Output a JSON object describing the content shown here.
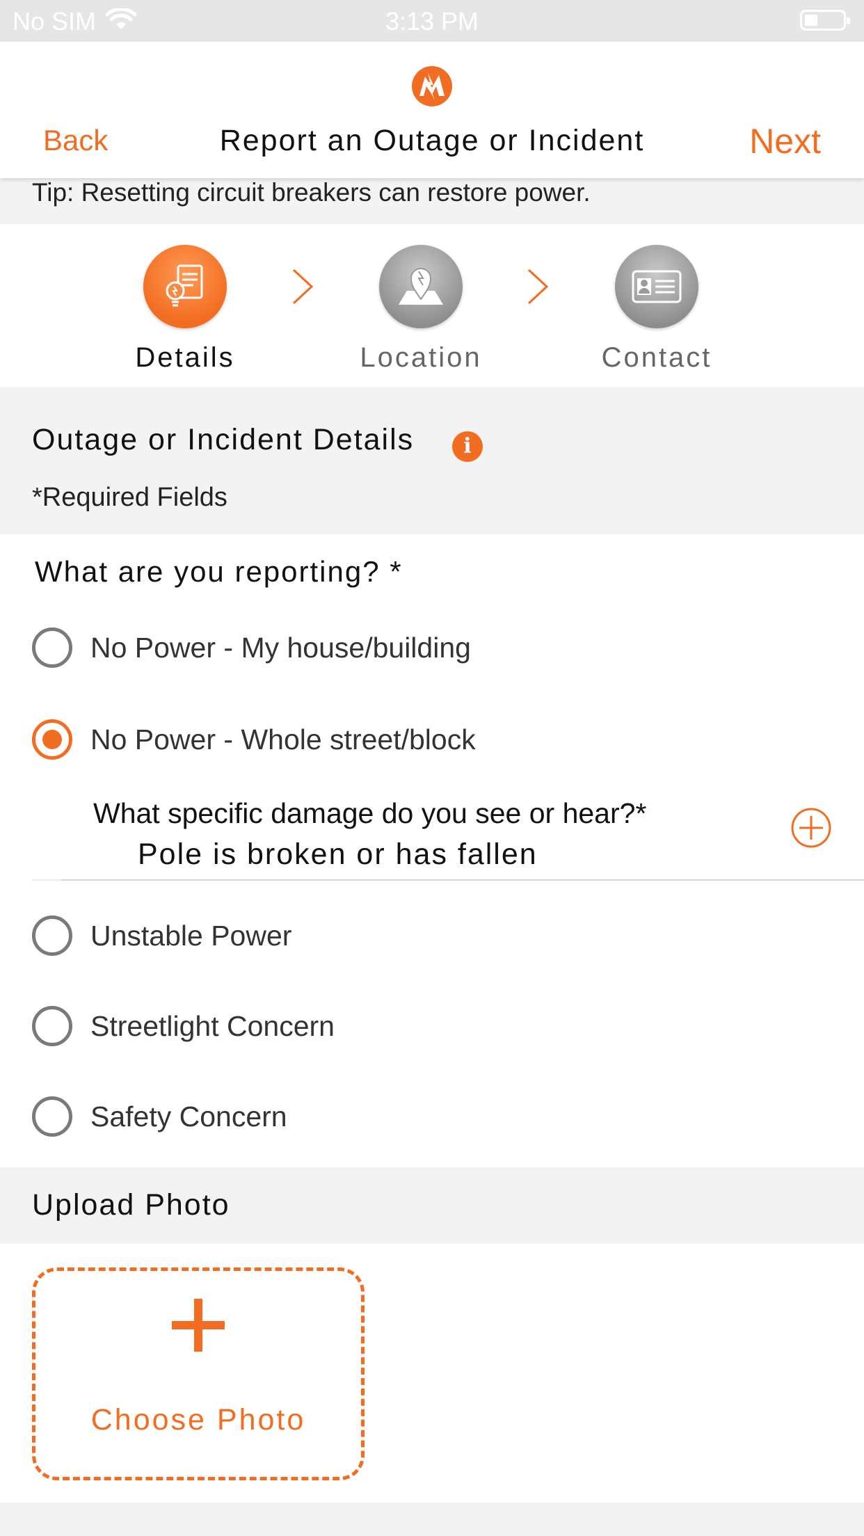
{
  "status_bar": {
    "carrier": "No SIM",
    "time": "3:13 PM",
    "wifi_icon": "wifi-icon",
    "battery_icon": "battery-icon"
  },
  "nav": {
    "back_label": "Back",
    "title": "Report an Outage or Incident",
    "next_label": "Next",
    "logo_icon": "brand-logo-icon"
  },
  "tip": "Tip: Resetting circuit breakers can restore power.",
  "steps": [
    {
      "label": "Details",
      "icon": "document-bulb-icon",
      "active": true
    },
    {
      "label": "Location",
      "icon": "map-pin-icon",
      "active": false
    },
    {
      "label": "Contact",
      "icon": "contact-card-icon",
      "active": false
    }
  ],
  "section": {
    "title": "Outage or Incident Details",
    "info_icon": "i",
    "required_note": "*Required Fields"
  },
  "form": {
    "question": "What are you reporting? *",
    "options": [
      {
        "label": "No Power - My house/building",
        "checked": false
      },
      {
        "label": "No Power - Whole street/block",
        "checked": true
      },
      {
        "label": "Unstable Power",
        "checked": false
      },
      {
        "label": "Streetlight Concern",
        "checked": false
      },
      {
        "label": "Safety Concern",
        "checked": false
      }
    ],
    "damage_question": "What specific damage do you see or hear?*",
    "damage_answer": "Pole is broken or has fallen"
  },
  "upload": {
    "title": "Upload Photo",
    "choose_label": "Choose Photo"
  },
  "colors": {
    "accent": "#f26d21",
    "background": "#f3f3f3",
    "status_bar": "#e6e6e6"
  }
}
